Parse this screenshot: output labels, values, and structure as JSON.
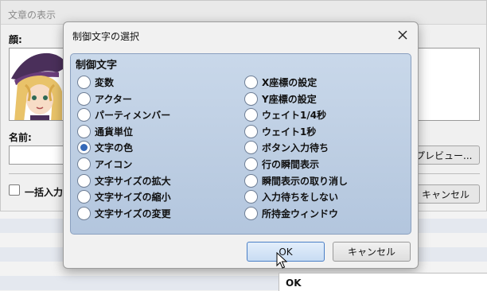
{
  "parent_window": {
    "title": "文章の表示",
    "face_label": "顔:",
    "name_label": "名前:",
    "preview_label": "プレビュー...",
    "batch_label": "一括入力",
    "cancel_label": "キャンセル"
  },
  "dialog": {
    "title": "制御文字の選択",
    "group_title": "制御文字",
    "options_left": [
      "変数",
      "アクター",
      "パーティメンバー",
      "通貨単位",
      "文字の色",
      "アイコン",
      "文字サイズの拡大",
      "文字サイズの縮小",
      "文字サイズの変更"
    ],
    "options_right": [
      "X座標の設定",
      "Y座標の設定",
      "ウェイト1/4秒",
      "ウェイト1秒",
      "ボタン入力待ち",
      "行の瞬間表示",
      "瞬間表示の取り消し",
      "入力待ちをしない",
      "所持金ウィンドウ"
    ],
    "selected": "文字の色",
    "ok_label": "OK",
    "cancel_label": "キャンセル"
  },
  "tooltip": {
    "text": "OK"
  },
  "colors": {
    "accent": "#3468b8",
    "panel": "#c3d3e7"
  }
}
